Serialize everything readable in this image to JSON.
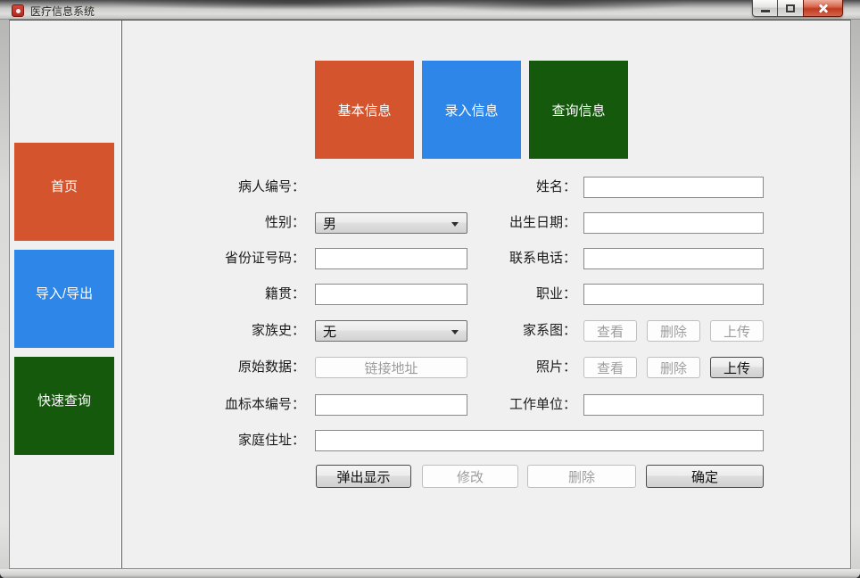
{
  "window": {
    "title": "医疗信息系统"
  },
  "colors": {
    "accent_orange": "#D4542E",
    "accent_blue": "#2E87E8",
    "accent_green": "#155A0C",
    "close_button_red": "#C03A20",
    "client_background": "#F0F0F0"
  },
  "sidebar": {
    "items": [
      {
        "label": "首页",
        "color": "#D4542E"
      },
      {
        "label": "导入/导出",
        "color": "#2E87E8"
      },
      {
        "label": "快速查询",
        "color": "#155A0C"
      }
    ]
  },
  "tabs": [
    {
      "label": "基本信息",
      "color": "#D4542E"
    },
    {
      "label": "录入信息",
      "color": "#2E87E8"
    },
    {
      "label": "查询信息",
      "color": "#155A0C"
    }
  ],
  "form": {
    "left": {
      "patient_number": {
        "label": "病人编号："
      },
      "gender": {
        "label": "性别：",
        "value": "男"
      },
      "id_card": {
        "label": "省份证号码：",
        "value": ""
      },
      "native_place": {
        "label": "籍贯：",
        "value": ""
      },
      "family_history": {
        "label": "家族史：",
        "value": "无"
      },
      "raw_data": {
        "label": "原始数据：",
        "button": "链接地址"
      },
      "blood_sample": {
        "label": "血标本编号：",
        "value": ""
      }
    },
    "right": {
      "name": {
        "label": "姓名：",
        "value": ""
      },
      "birth_date": {
        "label": "出生日期：",
        "value": ""
      },
      "phone": {
        "label": "联系电话：",
        "value": ""
      },
      "occupation": {
        "label": "职业：",
        "value": ""
      },
      "pedigree": {
        "label": "家系图：",
        "buttons": [
          {
            "label": "查看",
            "enabled": false
          },
          {
            "label": "删除",
            "enabled": false
          },
          {
            "label": "上传",
            "enabled": false
          }
        ]
      },
      "photo": {
        "label": "照片：",
        "buttons": [
          {
            "label": "查看",
            "enabled": false
          },
          {
            "label": "删除",
            "enabled": false
          },
          {
            "label": "上传",
            "enabled": true
          }
        ]
      },
      "workplace": {
        "label": "工作单位：",
        "value": ""
      }
    },
    "address": {
      "label": "家庭住址：",
      "value": ""
    },
    "actions": [
      {
        "label": "弹出显示",
        "enabled": true
      },
      {
        "label": "修改",
        "enabled": false
      },
      {
        "label": "删除",
        "enabled": false
      },
      {
        "label": "确定",
        "enabled": true
      }
    ]
  }
}
